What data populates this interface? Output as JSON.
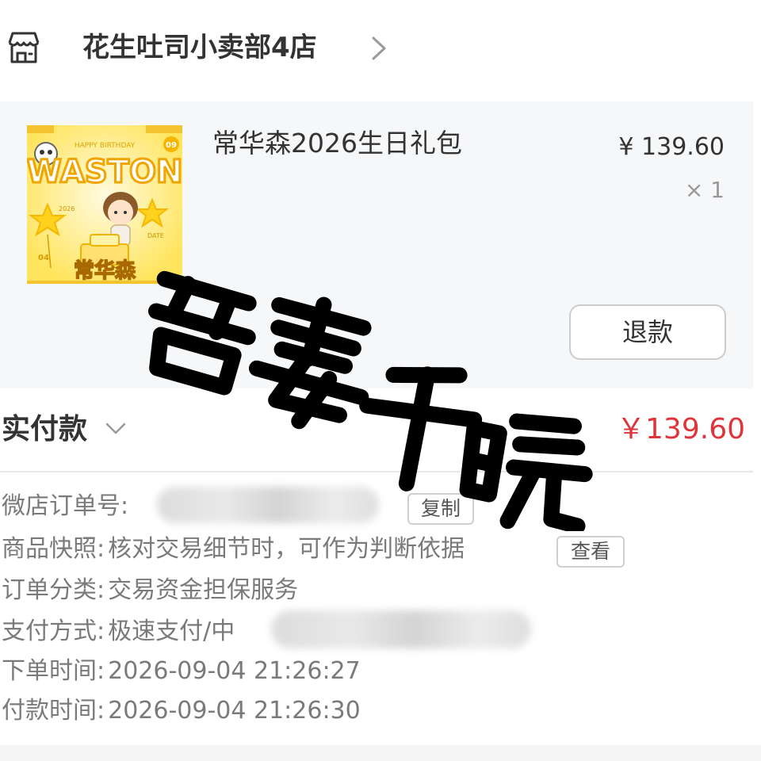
{
  "shop": {
    "name": "花生吐司小卖部4店",
    "icon": "store-icon"
  },
  "product": {
    "title": "常华森2026生日礼包",
    "price": "¥ 139.60",
    "quantity": "× 1",
    "refund_label": "退款",
    "thumbnail_text": [
      "HAPPY BIRTHDAY",
      "WASTON",
      "常华森",
      "09",
      "04",
      "2026",
      "DATE"
    ]
  },
  "payment": {
    "label": "实付款",
    "amount": "￥139.60"
  },
  "details": {
    "order_number_label": "微店订单号:",
    "copy_label": "复制",
    "snapshot_label": "商品快照:",
    "snapshot_value": "核对交易细节时，可作为判断依据",
    "view_label": "查看",
    "category_label": "订单分类:",
    "category_value": "交易资金担保服务",
    "payment_method_label": "支付方式:",
    "payment_method_value": "极速支付/中",
    "order_time_label": "下单时间:",
    "order_time_value": "2026-09-04 21:26:27",
    "pay_time_label": "付款时间:",
    "pay_time_value": "2026-09-04 21:26:30"
  },
  "watermark": {
    "text": "吾妻千晓"
  },
  "colors": {
    "price_red": "#e0343b",
    "card_background": "#f6f7f9",
    "thumbnail_yellow": "#ffe45c",
    "watermark_black": "#000000"
  }
}
